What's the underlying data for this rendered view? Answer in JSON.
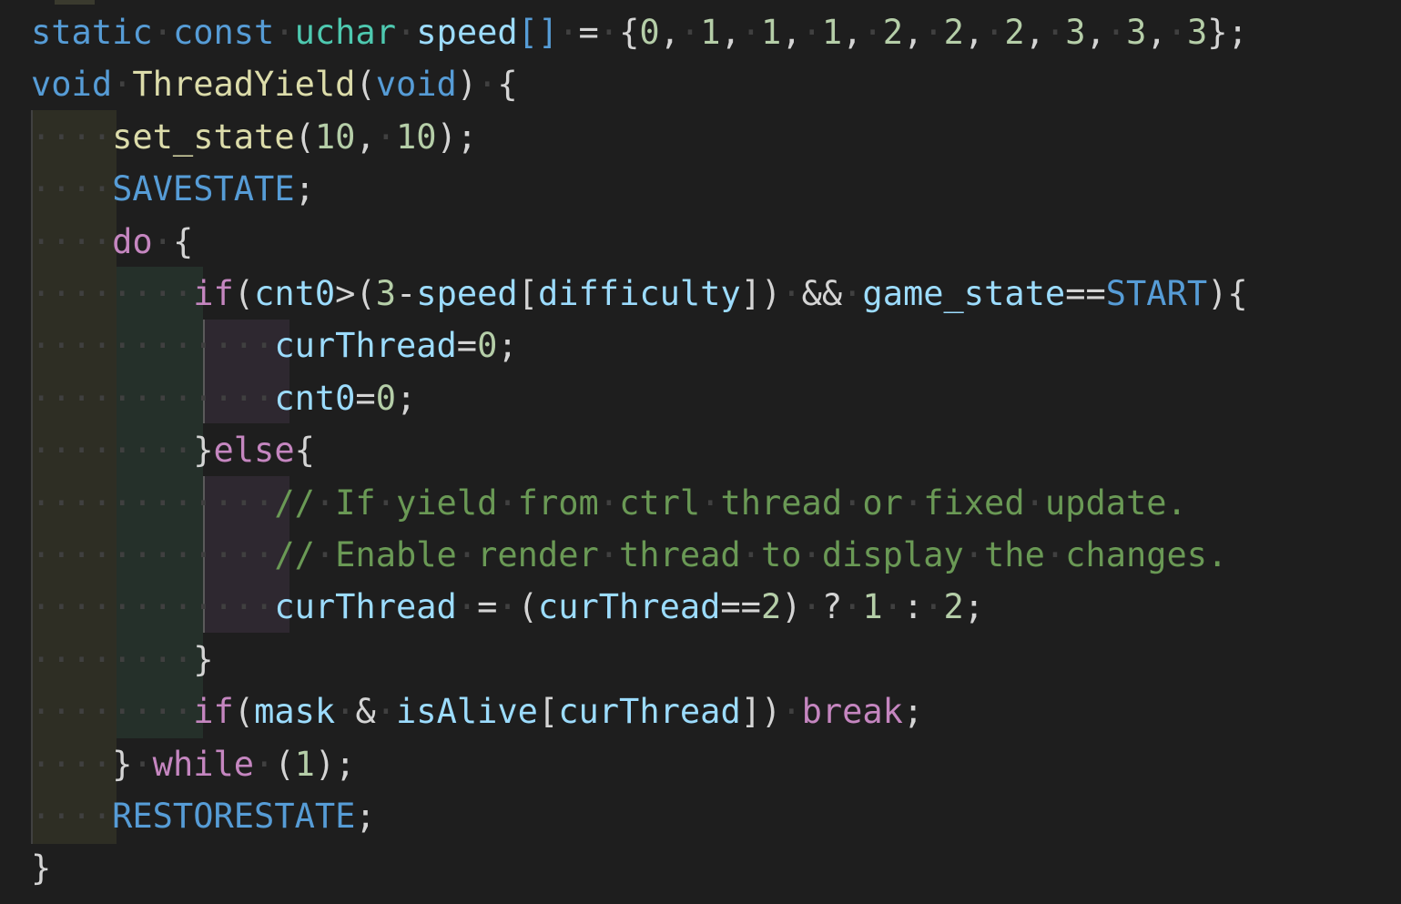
{
  "colors": {
    "background": "#1e1e1e",
    "keyword": "#569cd6",
    "type": "#4ec9b0",
    "variable": "#9cdcfe",
    "number": "#b5cea8",
    "function": "#dcdcaa",
    "control": "#c586c0",
    "comment": "#6a9955",
    "whitespace_dot": "#404040",
    "plain": "#d4d4d4"
  },
  "code": {
    "lines": [
      [
        [
          "kw",
          "static"
        ],
        [
          "ws",
          "·"
        ],
        [
          "kw",
          "const"
        ],
        [
          "ws",
          "·"
        ],
        [
          "type",
          "uchar"
        ],
        [
          "ws",
          "·"
        ],
        [
          "var",
          "speed"
        ],
        [
          "kw",
          "[]"
        ],
        [
          "ws",
          "·"
        ],
        [
          "op",
          "="
        ],
        [
          "ws",
          "·"
        ],
        [
          "pun",
          "{"
        ],
        [
          "num",
          "0"
        ],
        [
          "pun",
          ","
        ],
        [
          "ws",
          "·"
        ],
        [
          "num",
          "1"
        ],
        [
          "pun",
          ","
        ],
        [
          "ws",
          "·"
        ],
        [
          "num",
          "1"
        ],
        [
          "pun",
          ","
        ],
        [
          "ws",
          "·"
        ],
        [
          "num",
          "1"
        ],
        [
          "pun",
          ","
        ],
        [
          "ws",
          "·"
        ],
        [
          "num",
          "2"
        ],
        [
          "pun",
          ","
        ],
        [
          "ws",
          "·"
        ],
        [
          "num",
          "2"
        ],
        [
          "pun",
          ","
        ],
        [
          "ws",
          "·"
        ],
        [
          "num",
          "2"
        ],
        [
          "pun",
          ","
        ],
        [
          "ws",
          "·"
        ],
        [
          "num",
          "3"
        ],
        [
          "pun",
          ","
        ],
        [
          "ws",
          "·"
        ],
        [
          "num",
          "3"
        ],
        [
          "pun",
          ","
        ],
        [
          "ws",
          "·"
        ],
        [
          "num",
          "3"
        ],
        [
          "pun",
          "};"
        ]
      ],
      [
        [
          "kw",
          "void"
        ],
        [
          "ws",
          "·"
        ],
        [
          "fn",
          "ThreadYield"
        ],
        [
          "pun",
          "("
        ],
        [
          "kw",
          "void"
        ],
        [
          "pun",
          ")"
        ],
        [
          "ws",
          "·"
        ],
        [
          "pun",
          "{"
        ]
      ],
      [
        [
          "ws",
          "····"
        ],
        [
          "fn",
          "set_state"
        ],
        [
          "pun",
          "("
        ],
        [
          "num",
          "10"
        ],
        [
          "pun",
          ","
        ],
        [
          "ws",
          "·"
        ],
        [
          "num",
          "10"
        ],
        [
          "pun",
          ");"
        ]
      ],
      [
        [
          "ws",
          "····"
        ],
        [
          "mac",
          "SAVESTATE"
        ],
        [
          "pun",
          ";"
        ]
      ],
      [
        [
          "ws",
          "····"
        ],
        [
          "ctl",
          "do"
        ],
        [
          "ws",
          "·"
        ],
        [
          "pun",
          "{"
        ]
      ],
      [
        [
          "ws",
          "········"
        ],
        [
          "ctl",
          "if"
        ],
        [
          "pun",
          "("
        ],
        [
          "var",
          "cnt0"
        ],
        [
          "op",
          ">"
        ],
        [
          "pun",
          "("
        ],
        [
          "num",
          "3"
        ],
        [
          "op",
          "-"
        ],
        [
          "var",
          "speed"
        ],
        [
          "pun",
          "["
        ],
        [
          "var",
          "difficulty"
        ],
        [
          "pun",
          "])"
        ],
        [
          "ws",
          "·"
        ],
        [
          "op",
          "&&"
        ],
        [
          "ws",
          "·"
        ],
        [
          "var",
          "game_state"
        ],
        [
          "op",
          "=="
        ],
        [
          "mac",
          "START"
        ],
        [
          "pun",
          "){"
        ]
      ],
      [
        [
          "ws",
          "············"
        ],
        [
          "var",
          "curThread"
        ],
        [
          "op",
          "="
        ],
        [
          "num",
          "0"
        ],
        [
          "pun",
          ";"
        ]
      ],
      [
        [
          "ws",
          "············"
        ],
        [
          "var",
          "cnt0"
        ],
        [
          "op",
          "="
        ],
        [
          "num",
          "0"
        ],
        [
          "pun",
          ";"
        ]
      ],
      [
        [
          "ws",
          "········"
        ],
        [
          "pun",
          "}"
        ],
        [
          "ctl",
          "else"
        ],
        [
          "pun",
          "{"
        ]
      ],
      [
        [
          "ws",
          "············"
        ],
        [
          "com",
          "//"
        ],
        [
          "ws",
          "·"
        ],
        [
          "com",
          "If"
        ],
        [
          "ws",
          "·"
        ],
        [
          "com",
          "yield"
        ],
        [
          "ws",
          "·"
        ],
        [
          "com",
          "from"
        ],
        [
          "ws",
          "·"
        ],
        [
          "com",
          "ctrl"
        ],
        [
          "ws",
          "·"
        ],
        [
          "com",
          "thread"
        ],
        [
          "ws",
          "·"
        ],
        [
          "com",
          "or"
        ],
        [
          "ws",
          "·"
        ],
        [
          "com",
          "fixed"
        ],
        [
          "ws",
          "·"
        ],
        [
          "com",
          "update."
        ]
      ],
      [
        [
          "ws",
          "············"
        ],
        [
          "com",
          "//"
        ],
        [
          "ws",
          "·"
        ],
        [
          "com",
          "Enable"
        ],
        [
          "ws",
          "·"
        ],
        [
          "com",
          "render"
        ],
        [
          "ws",
          "·"
        ],
        [
          "com",
          "thread"
        ],
        [
          "ws",
          "·"
        ],
        [
          "com",
          "to"
        ],
        [
          "ws",
          "·"
        ],
        [
          "com",
          "display"
        ],
        [
          "ws",
          "·"
        ],
        [
          "com",
          "the"
        ],
        [
          "ws",
          "·"
        ],
        [
          "com",
          "changes."
        ]
      ],
      [
        [
          "ws",
          "············"
        ],
        [
          "var",
          "curThread"
        ],
        [
          "ws",
          "·"
        ],
        [
          "op",
          "="
        ],
        [
          "ws",
          "·"
        ],
        [
          "pun",
          "("
        ],
        [
          "var",
          "curThread"
        ],
        [
          "op",
          "=="
        ],
        [
          "num",
          "2"
        ],
        [
          "pun",
          ")"
        ],
        [
          "ws",
          "·"
        ],
        [
          "op",
          "?"
        ],
        [
          "ws",
          "·"
        ],
        [
          "num",
          "1"
        ],
        [
          "ws",
          "·"
        ],
        [
          "op",
          ":"
        ],
        [
          "ws",
          "·"
        ],
        [
          "num",
          "2"
        ],
        [
          "pun",
          ";"
        ]
      ],
      [
        [
          "ws",
          "········"
        ],
        [
          "pun",
          "}"
        ]
      ],
      [
        [
          "ws",
          "········"
        ],
        [
          "ctl",
          "if"
        ],
        [
          "pun",
          "("
        ],
        [
          "var",
          "mask"
        ],
        [
          "ws",
          "·"
        ],
        [
          "op",
          "&"
        ],
        [
          "ws",
          "·"
        ],
        [
          "var",
          "isAlive"
        ],
        [
          "pun",
          "["
        ],
        [
          "var",
          "curThread"
        ],
        [
          "pun",
          "])"
        ],
        [
          "ws",
          "·"
        ],
        [
          "ctl",
          "break"
        ],
        [
          "pun",
          ";"
        ]
      ],
      [
        [
          "ws",
          "····"
        ],
        [
          "pun",
          "}"
        ],
        [
          "ws",
          "·"
        ],
        [
          "ctl",
          "while"
        ],
        [
          "ws",
          "·"
        ],
        [
          "pun",
          "("
        ],
        [
          "num",
          "1"
        ],
        [
          "pun",
          ");"
        ]
      ],
      [
        [
          "ws",
          "····"
        ],
        [
          "mac",
          "RESTORESTATE"
        ],
        [
          "pun",
          ";"
        ]
      ],
      [
        [
          "pun",
          "}"
        ]
      ]
    ]
  }
}
